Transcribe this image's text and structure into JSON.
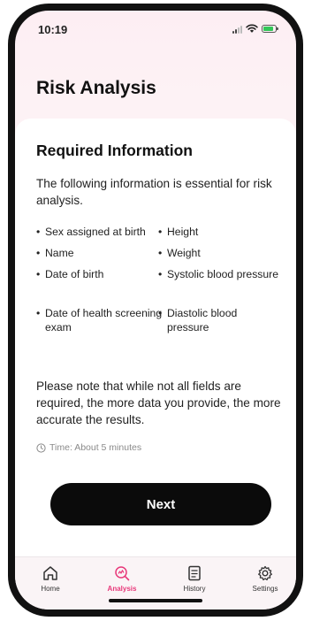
{
  "status_bar": {
    "time": "10:19",
    "battery_level": 0.7
  },
  "header": {
    "title": "Risk Analysis"
  },
  "card": {
    "title": "Required Information",
    "intro": "The following information is essential for risk analysis.",
    "left_items": [
      "Sex assigned at birth",
      "Name",
      "Date of birth",
      "Date of health screening exam"
    ],
    "right_items": [
      "Height",
      "Weight",
      "Systolic blood pressure",
      "Diastolic blood pressure"
    ],
    "note": "Please note that while not all fields are required, the more data you provide, the more accurate the results.",
    "time_estimate": "Time: About 5 minutes",
    "next_label": "Next"
  },
  "tabs": [
    {
      "label": "Home",
      "icon": "home-icon",
      "active": false
    },
    {
      "label": "Analysis",
      "icon": "analysis-icon",
      "active": true
    },
    {
      "label": "History",
      "icon": "history-icon",
      "active": false
    },
    {
      "label": "Settings",
      "icon": "gear-icon",
      "active": false
    }
  ],
  "colors": {
    "accent": "#e8387a",
    "button": "#0b0b0b",
    "background_tint": "#fdeef3"
  }
}
